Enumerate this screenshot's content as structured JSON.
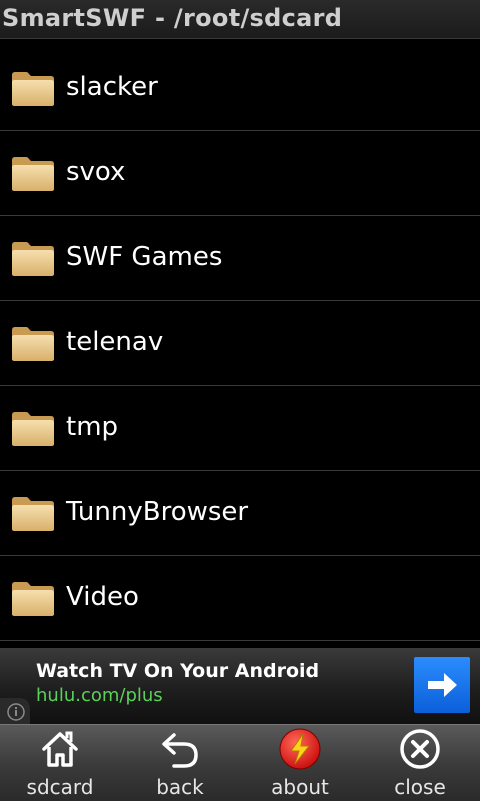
{
  "window": {
    "title": "SmartSWF - /root/sdcard"
  },
  "folders": [
    {
      "label": "slacker"
    },
    {
      "label": "svox"
    },
    {
      "label": "SWF Games"
    },
    {
      "label": "telenav"
    },
    {
      "label": "tmp"
    },
    {
      "label": "TunnyBrowser"
    },
    {
      "label": "Video"
    }
  ],
  "ad": {
    "headline": "Watch TV On Your Android",
    "url": "hulu.com/plus",
    "url_color": "#5bd15b",
    "button_color": "#1a73e8"
  },
  "toolbar": {
    "items": [
      {
        "label": "sdcard",
        "icon": "home-icon"
      },
      {
        "label": "back",
        "icon": "back-arrow-icon"
      },
      {
        "label": "about",
        "icon": "lightning-icon"
      },
      {
        "label": "close",
        "icon": "close-icon"
      }
    ]
  }
}
